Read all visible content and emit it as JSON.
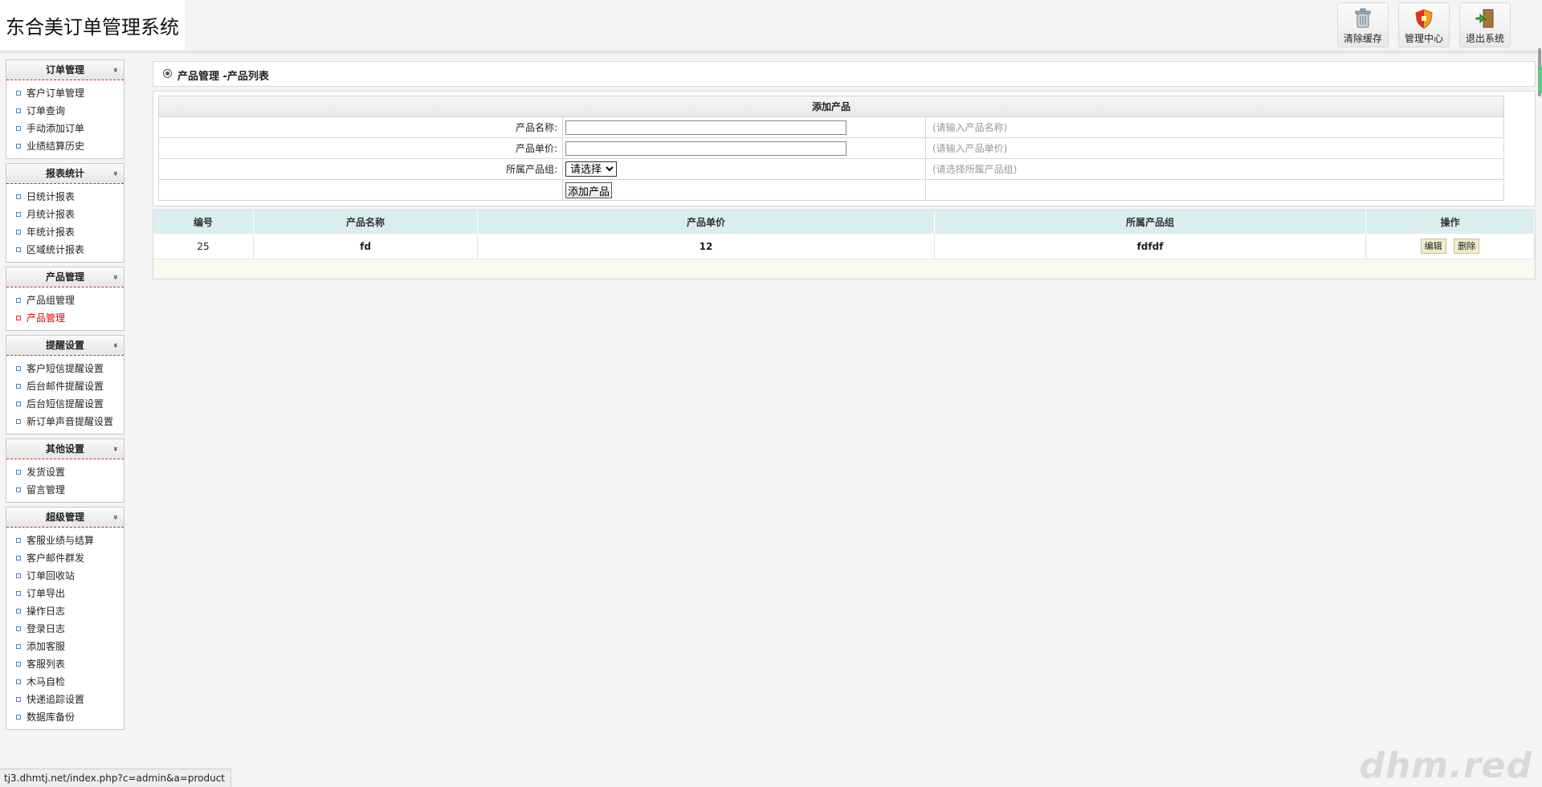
{
  "header": {
    "app_title": "东合美订单管理系统",
    "buttons": [
      {
        "label": "清除缓存",
        "icon": "trash-bin-icon"
      },
      {
        "label": "管理中心",
        "icon": "shield-icon"
      },
      {
        "label": "退出系统",
        "icon": "exit-door-icon"
      }
    ]
  },
  "sidebar": {
    "groups": [
      {
        "title": "订单管理",
        "items": [
          "客户订单管理",
          "订单查询",
          "手动添加订单",
          "业绩结算历史"
        ]
      },
      {
        "title": "报表统计",
        "items": [
          "日统计报表",
          "月统计报表",
          "年统计报表",
          "区域统计报表"
        ]
      },
      {
        "title": "产品管理",
        "items": [
          "产品组管理",
          "产品管理"
        ]
      },
      {
        "title": "提醒设置",
        "items": [
          "客户短信提醒设置",
          "后台邮件提醒设置",
          "后台短信提醒设置",
          "新订单声音提醒设置"
        ]
      },
      {
        "title": "其他设置",
        "items": [
          "发货设置",
          "留言管理"
        ]
      },
      {
        "title": "超级管理",
        "items": [
          "客服业绩与结算",
          "客户邮件群发",
          "订单回收站",
          "订单导出",
          "操作日志",
          "登录日志",
          "添加客服",
          "客服列表",
          "木马自检",
          "快递追踪设置",
          "数据库备份"
        ]
      }
    ],
    "active_item": "产品管理",
    "chevron_glyph": "»"
  },
  "breadcrumb": {
    "text": "产品管理 -产品列表"
  },
  "add_form": {
    "title": "添加产品",
    "name_label": "产品名称:",
    "name_hint": "(请输入产品名称)",
    "name_value": "",
    "price_label": "产品单价:",
    "price_hint": "(请输入产品单价)",
    "price_value": "",
    "group_label": "所属产品组:",
    "group_selected": "请选择",
    "group_hint": "(请选择所属产品组)",
    "submit_label": "添加产品"
  },
  "product_table": {
    "columns": [
      "编号",
      "产品名称",
      "产品单价",
      "所属产品组",
      "操作"
    ],
    "rows": [
      {
        "id": "25",
        "name": "fd",
        "price": "12",
        "group": "fdfdf",
        "edit": "编辑",
        "delete": "删除"
      }
    ]
  },
  "status_bar": {
    "url": "tj3.dhmtj.net/index.php?c=admin&a=product"
  },
  "watermark": "dhm.red",
  "colors": {
    "active_menu": "#e00000",
    "table_head": "#daeef0",
    "menu_divider": "#c0392b"
  }
}
